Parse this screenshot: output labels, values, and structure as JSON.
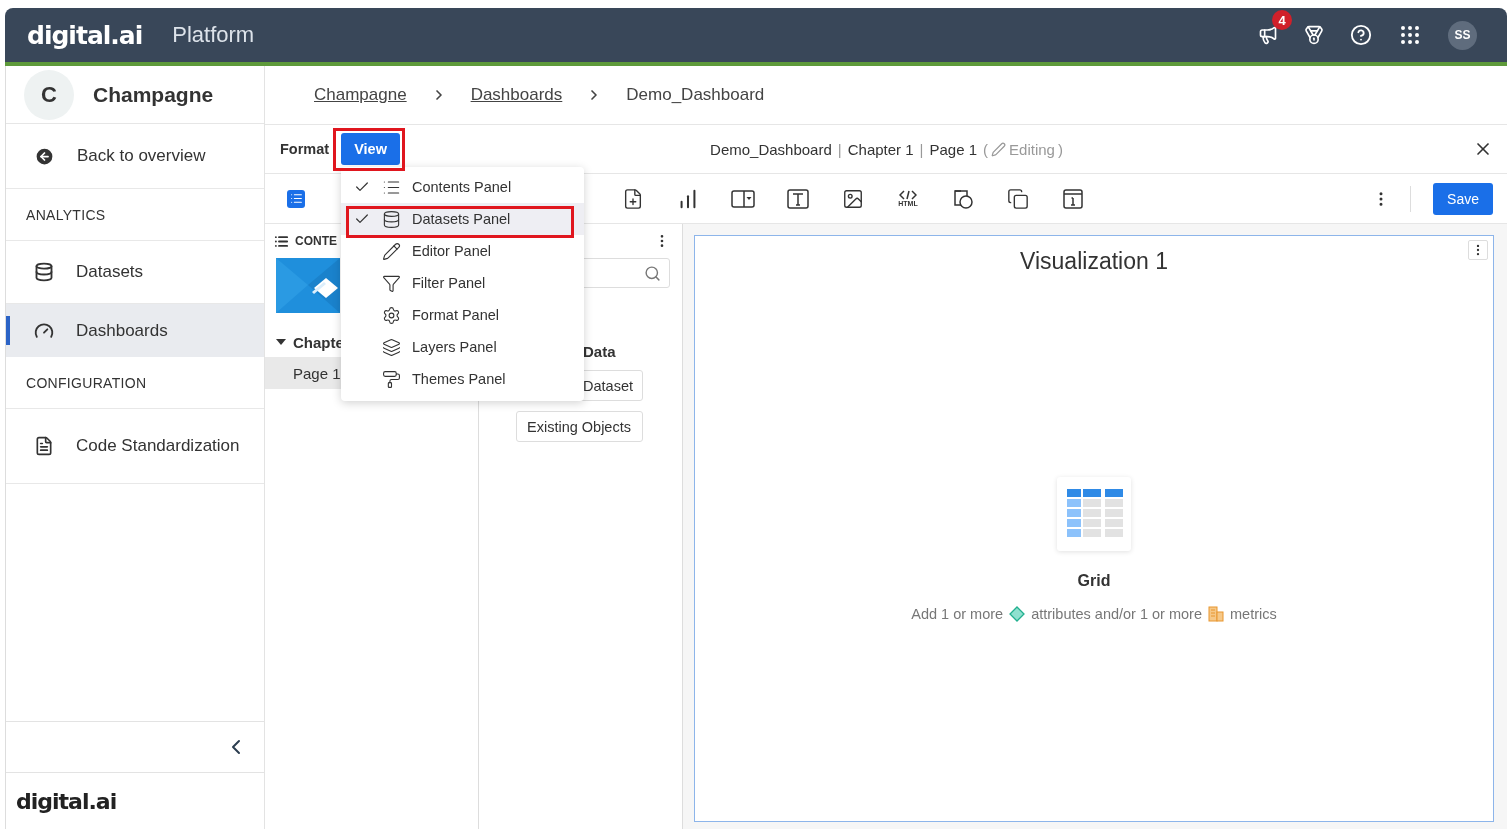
{
  "header": {
    "logo": "digital.ai",
    "product": "Platform",
    "notification_count": "4",
    "avatar": "SS"
  },
  "sidebar": {
    "workspace": {
      "initial": "C",
      "name": "Champagne"
    },
    "back": "Back to overview",
    "sections": [
      {
        "title": "ANALYTICS",
        "items": [
          {
            "label": "Datasets",
            "kind": "database",
            "selected": false
          },
          {
            "label": "Dashboards",
            "kind": "gauge",
            "selected": true
          }
        ]
      },
      {
        "title": "CONFIGURATION",
        "items": [
          {
            "label": "Code Standardization",
            "kind": "file",
            "selected": false
          }
        ]
      }
    ],
    "footer_logo": "digital.ai"
  },
  "breadcrumb": [
    {
      "label": "Champagne",
      "link": true
    },
    {
      "label": "Dashboards",
      "link": true
    },
    {
      "label": "Demo_Dashboard",
      "link": false
    }
  ],
  "editor_bar": {
    "tabs": [
      {
        "label": "Format",
        "selected": false
      },
      {
        "label": "View",
        "selected": true
      }
    ],
    "title_items": [
      {
        "kind": "text",
        "text": "Demo_Dashboard"
      },
      {
        "kind": "separator",
        "text": "|"
      },
      {
        "kind": "text",
        "text": "Chapter 1"
      },
      {
        "kind": "separator",
        "text": "|"
      },
      {
        "kind": "text",
        "text": "Page 1"
      }
    ],
    "status_open": "(",
    "status": "Editing",
    "status_close": ")"
  },
  "toolbar": {
    "html_label": "HTML",
    "save": "Save"
  },
  "view_menu": [
    {
      "label": "Contents Panel",
      "kind": "list",
      "checked": true,
      "highlighted": false
    },
    {
      "label": "Datasets Panel",
      "kind": "database",
      "checked": true,
      "highlighted": true
    },
    {
      "label": "Editor Panel",
      "kind": "pencil",
      "checked": false,
      "highlighted": false
    },
    {
      "label": "Filter Panel",
      "kind": "filter",
      "checked": false,
      "highlighted": false
    },
    {
      "label": "Format Panel",
      "kind": "gear",
      "checked": false,
      "highlighted": false
    },
    {
      "label": "Layers Panel",
      "kind": "layers",
      "checked": false,
      "highlighted": false
    },
    {
      "label": "Themes Panel",
      "kind": "roller",
      "checked": false,
      "highlighted": false
    }
  ],
  "contents_panel": {
    "heading": "CONTE",
    "chapter": "Chapte",
    "page": "Page 1"
  },
  "datasets_panel": {
    "heading": "Data",
    "buttons": [
      "Dataset",
      "Existing Objects"
    ]
  },
  "visualization": {
    "title": "Visualization 1",
    "type": "Grid",
    "hint": [
      "Add 1 or more",
      "attributes and/or 1 or more",
      "metrics"
    ]
  }
}
